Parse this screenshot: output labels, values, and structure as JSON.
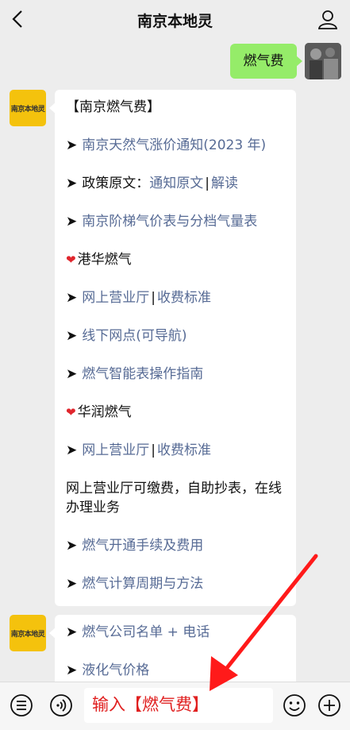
{
  "header": {
    "title": "南京本地灵"
  },
  "outgoing": {
    "text": "燃气费"
  },
  "bot": {
    "avatar_label": "南京本地灵"
  },
  "message1": {
    "title": "【南京燃气费】",
    "item1": "南京天然气涨价通知(2023 年)",
    "item2_prefix": "政策原文：",
    "item2_link1": "通知原文",
    "item2_sep": "|",
    "item2_link2": "解读",
    "item3": "南京阶梯气价表与分档气量表",
    "section1": "港华燃气",
    "item4_link1": "网上营业厅",
    "item4_sep": "|",
    "item4_link2": "收费标准",
    "item5": "线下网点(可导航)",
    "item6": "燃气智能表操作指南",
    "section2": "华润燃气",
    "item7_link1": "网上营业厅",
    "item7_sep": "|",
    "item7_link2": "收费标准",
    "note": "网上营业厅可缴费，自助抄表，在线办理业务",
    "item8": "燃气开通手续及费用",
    "item9": "燃气计算周期与方法"
  },
  "message2": {
    "item1": "燃气公司名单 + 电话",
    "item2": "液化气价格"
  },
  "toolbar": {
    "input_text": "输入【燃气费】"
  },
  "colors": {
    "link": "#576b95",
    "bubble_out": "#95ec69",
    "annotation": "#e02020"
  }
}
